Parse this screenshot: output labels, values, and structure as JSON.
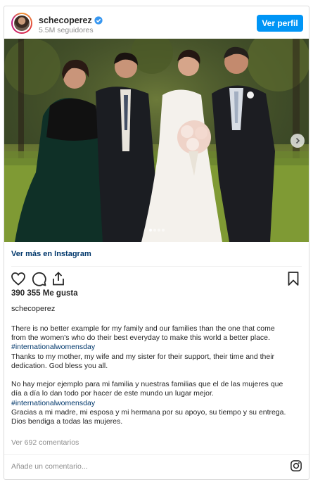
{
  "header": {
    "username": "schecoperez",
    "followers": "5.5M seguidores",
    "view_profile": "Ver perfil",
    "verified_color": "#3897f0",
    "button_color": "#0095f6"
  },
  "photo": {
    "alt_icon": "wedding-family-photo",
    "next_icon": "chevron-right-icon",
    "dots_total": 4,
    "active_dot": 1
  },
  "more_link": "Ver más en Instagram",
  "actions": {
    "icons": [
      "heart-icon",
      "comment-icon",
      "share-icon",
      "bookmark-icon"
    ]
  },
  "likes": "390 355 Me gusta",
  "caption_user": "schecoperez",
  "caption": {
    "en_line1": "There is no better example for my family and our families than the one that come",
    "en_line2": "from the women's who do their best everyday to make this world a better place.",
    "en_tag": "#internationalwomensday",
    "en_line3": "Thanks to my mother, my wife and my sister for their support, their time and their",
    "en_line4": "dedication. God bless you all.",
    "es_line1": "No hay mejor ejemplo para mi familia y nuestras familias que el de las mujeres que",
    "es_line2": "día a día lo dan todo por hacer de este mundo un lugar mejor.",
    "es_tag": "#internationalwomensday",
    "es_line3": "Gracias a mi madre, mi esposa y mi hermana por su apoyo, su tiempo y su entrega.",
    "es_line4": "Dios bendiga a todas las mujeres."
  },
  "comments_link": "Ver 692 comentarios",
  "comment_placeholder": "Añade un comentario...",
  "footer_icon": "instagram-icon"
}
